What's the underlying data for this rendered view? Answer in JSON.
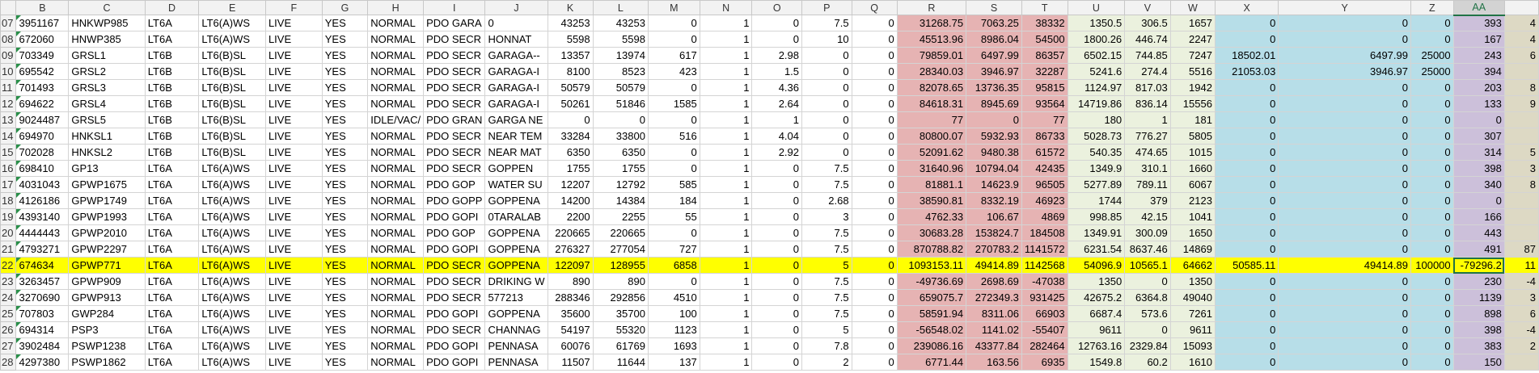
{
  "columns": [
    "",
    "B",
    "C",
    "D",
    "E",
    "F",
    "G",
    "H",
    "I",
    "J",
    "K",
    "L",
    "M",
    "N",
    "O",
    "P",
    "Q",
    "R",
    "S",
    "T",
    "U",
    "V",
    "W",
    "X",
    "Y",
    "Z",
    "AA",
    ""
  ],
  "rows": [
    {
      "rn": "07",
      "cells": [
        "3951167",
        "HNKWP985",
        "LT6A",
        "LT6(A)WS",
        "LIVE",
        "YES",
        "NORMAL",
        "PDO GARA",
        "0",
        "43253",
        "43253",
        "0",
        "1",
        "0",
        "7.5",
        "0",
        "31268.75",
        "7063.25",
        "38332",
        "1350.5",
        "306.5",
        "1657",
        "0",
        "0",
        "0",
        "393",
        "4"
      ]
    },
    {
      "rn": "08",
      "cells": [
        "672060",
        "HNWP385",
        "LT6A",
        "LT6(A)WS",
        "LIVE",
        "YES",
        "NORMAL",
        "PDO SECR",
        "HONNAT",
        "5598",
        "5598",
        "0",
        "1",
        "0",
        "10",
        "0",
        "45513.96",
        "8986.04",
        "54500",
        "1800.26",
        "446.74",
        "2247",
        "0",
        "0",
        "0",
        "167",
        "4"
      ]
    },
    {
      "rn": "09",
      "cells": [
        "703349",
        "GRSL1",
        "LT6B",
        "LT6(B)SL",
        "LIVE",
        "YES",
        "NORMAL",
        "PDO SECR",
        "GARAGA--",
        "13357",
        "13974",
        "617",
        "1",
        "2.98",
        "0",
        "0",
        "79859.01",
        "6497.99",
        "86357",
        "6502.15",
        "744.85",
        "7247",
        "18502.01",
        "6497.99",
        "25000",
        "243",
        "6"
      ]
    },
    {
      "rn": "10",
      "cells": [
        "695542",
        "GRSL2",
        "LT6B",
        "LT6(B)SL",
        "LIVE",
        "YES",
        "NORMAL",
        "PDO SECR",
        "GARAGA-I",
        "8100",
        "8523",
        "423",
        "1",
        "1.5",
        "0",
        "0",
        "28340.03",
        "3946.97",
        "32287",
        "5241.6",
        "274.4",
        "5516",
        "21053.03",
        "3946.97",
        "25000",
        "394",
        ""
      ]
    },
    {
      "rn": "11",
      "cells": [
        "701493",
        "GRSL3",
        "LT6B",
        "LT6(B)SL",
        "LIVE",
        "YES",
        "NORMAL",
        "PDO SECR",
        "GARAGA-I",
        "50579",
        "50579",
        "0",
        "1",
        "4.36",
        "0",
        "0",
        "82078.65",
        "13736.35",
        "95815",
        "1124.97",
        "817.03",
        "1942",
        "0",
        "0",
        "0",
        "203",
        "8"
      ]
    },
    {
      "rn": "12",
      "cells": [
        "694622",
        "GRSL4",
        "LT6B",
        "LT6(B)SL",
        "LIVE",
        "YES",
        "NORMAL",
        "PDO SECR",
        "GARAGA-I",
        "50261",
        "51846",
        "1585",
        "1",
        "2.64",
        "0",
        "0",
        "84618.31",
        "8945.69",
        "93564",
        "14719.86",
        "836.14",
        "15556",
        "0",
        "0",
        "0",
        "133",
        "9"
      ]
    },
    {
      "rn": "13",
      "cells": [
        "9024487",
        "GRSL5",
        "LT6B",
        "LT6(B)SL",
        "LIVE",
        "YES",
        "IDLE/VAC/",
        "PDO GRAN",
        "GARGA NE",
        "0",
        "0",
        "0",
        "1",
        "1",
        "0",
        "0",
        "77",
        "0",
        "77",
        "180",
        "1",
        "181",
        "0",
        "0",
        "0",
        "0",
        ""
      ]
    },
    {
      "rn": "14",
      "cells": [
        "694970",
        "HNKSL1",
        "LT6B",
        "LT6(B)SL",
        "LIVE",
        "YES",
        "NORMAL",
        "PDO SECR",
        "NEAR TEM",
        "33284",
        "33800",
        "516",
        "1",
        "4.04",
        "0",
        "0",
        "80800.07",
        "5932.93",
        "86733",
        "5028.73",
        "776.27",
        "5805",
        "0",
        "0",
        "0",
        "307",
        ""
      ]
    },
    {
      "rn": "15",
      "cells": [
        "702028",
        "HNKSL2",
        "LT6B",
        "LT6(B)SL",
        "LIVE",
        "YES",
        "NORMAL",
        "PDO SECR",
        "NEAR MAT",
        "6350",
        "6350",
        "0",
        "1",
        "2.92",
        "0",
        "0",
        "52091.62",
        "9480.38",
        "61572",
        "540.35",
        "474.65",
        "1015",
        "0",
        "0",
        "0",
        "314",
        "5"
      ]
    },
    {
      "rn": "16",
      "cells": [
        "698410",
        "GP13",
        "LT6A",
        "LT6(A)WS",
        "LIVE",
        "YES",
        "NORMAL",
        "PDO SECR",
        "GOPPEN",
        "1755",
        "1755",
        "0",
        "1",
        "0",
        "7.5",
        "0",
        "31640.96",
        "10794.04",
        "42435",
        "1349.9",
        "310.1",
        "1660",
        "0",
        "0",
        "0",
        "398",
        "3"
      ]
    },
    {
      "rn": "17",
      "cells": [
        "4031043",
        "GPWP1675",
        "LT6A",
        "LT6(A)WS",
        "LIVE",
        "YES",
        "NORMAL",
        "PDO GOP",
        "WATER SU",
        "12207",
        "12792",
        "585",
        "1",
        "0",
        "7.5",
        "0",
        "81881.1",
        "14623.9",
        "96505",
        "5277.89",
        "789.11",
        "6067",
        "0",
        "0",
        "0",
        "340",
        "8"
      ]
    },
    {
      "rn": "18",
      "cells": [
        "4126186",
        "GPWP1749",
        "LT6A",
        "LT6(A)WS",
        "LIVE",
        "YES",
        "NORMAL",
        "PDO GOPP",
        "GOPPENA",
        "14200",
        "14384",
        "184",
        "1",
        "0",
        "2.68",
        "0",
        "38590.81",
        "8332.19",
        "46923",
        "1744",
        "379",
        "2123",
        "0",
        "0",
        "0",
        "0",
        ""
      ]
    },
    {
      "rn": "19",
      "cells": [
        "4393140",
        "GPWP1993",
        "LT6A",
        "LT6(A)WS",
        "LIVE",
        "YES",
        "NORMAL",
        "PDO GOPI",
        "0TARALAB",
        "2200",
        "2255",
        "55",
        "1",
        "0",
        "3",
        "0",
        "4762.33",
        "106.67",
        "4869",
        "998.85",
        "42.15",
        "1041",
        "0",
        "0",
        "0",
        "166",
        ""
      ]
    },
    {
      "rn": "20",
      "cells": [
        "4444443",
        "GPWP2010",
        "LT6A",
        "LT6(A)WS",
        "LIVE",
        "YES",
        "NORMAL",
        "PDO GOP",
        "GOPPENA",
        "220665",
        "220665",
        "0",
        "1",
        "0",
        "7.5",
        "0",
        "30683.28",
        "153824.7",
        "184508",
        "1349.91",
        "300.09",
        "1650",
        "0",
        "0",
        "0",
        "443",
        ""
      ]
    },
    {
      "rn": "21",
      "cells": [
        "4793271",
        "GPWP2297",
        "LT6A",
        "LT6(A)WS",
        "LIVE",
        "YES",
        "NORMAL",
        "PDO GOPI",
        "GOPPENA",
        "276327",
        "277054",
        "727",
        "1",
        "0",
        "7.5",
        "0",
        "870788.82",
        "270783.2",
        "1141572",
        "6231.54",
        "8637.46",
        "14869",
        "0",
        "0",
        "0",
        "491",
        "87"
      ]
    },
    {
      "rn": "22",
      "cells": [
        "674634",
        "GPWP771",
        "LT6A",
        "LT6(A)WS",
        "LIVE",
        "YES",
        "NORMAL",
        "PDO SECR",
        "GOPPENA",
        "122097",
        "128955",
        "6858",
        "1",
        "0",
        "5",
        "0",
        "1093153.11",
        "49414.89",
        "1142568",
        "54096.9",
        "10565.1",
        "64662",
        "50585.11",
        "49414.89",
        "100000",
        "-79296.2",
        "11"
      ],
      "highlight": true
    },
    {
      "rn": "23",
      "cells": [
        "3263457",
        "GPWP909",
        "LT6A",
        "LT6(A)WS",
        "LIVE",
        "YES",
        "NORMAL",
        "PDO SECR",
        "DRIKING W",
        "890",
        "890",
        "0",
        "1",
        "0",
        "7.5",
        "0",
        "-49736.69",
        "2698.69",
        "-47038",
        "1350",
        "0",
        "1350",
        "0",
        "0",
        "0",
        "230",
        "-4"
      ]
    },
    {
      "rn": "24",
      "cells": [
        "3270690",
        "GPWP913",
        "LT6A",
        "LT6(A)WS",
        "LIVE",
        "YES",
        "NORMAL",
        "PDO SECR",
        "577213",
        "288346",
        "292856",
        "4510",
        "1",
        "0",
        "7.5",
        "0",
        "659075.7",
        "272349.3",
        "931425",
        "42675.2",
        "6364.8",
        "49040",
        "0",
        "0",
        "0",
        "1139",
        "3"
      ]
    },
    {
      "rn": "25",
      "cells": [
        "707803",
        "GWP284",
        "LT6A",
        "LT6(A)WS",
        "LIVE",
        "YES",
        "NORMAL",
        "PDO GOPI",
        "GOPPENA",
        "35600",
        "35700",
        "100",
        "1",
        "0",
        "7.5",
        "0",
        "58591.94",
        "8311.06",
        "66903",
        "6687.4",
        "573.6",
        "7261",
        "0",
        "0",
        "0",
        "898",
        "6"
      ]
    },
    {
      "rn": "26",
      "cells": [
        "694314",
        "PSP3",
        "LT6A",
        "LT6(A)WS",
        "LIVE",
        "YES",
        "NORMAL",
        "PDO SECR",
        "CHANNAG",
        "54197",
        "55320",
        "1123",
        "1",
        "0",
        "5",
        "0",
        "-56548.02",
        "1141.02",
        "-55407",
        "9611",
        "0",
        "9611",
        "0",
        "0",
        "0",
        "398",
        "-4"
      ]
    },
    {
      "rn": "27",
      "cells": [
        "3902484",
        "PSWP1238",
        "LT6A",
        "LT6(A)WS",
        "LIVE",
        "YES",
        "NORMAL",
        "PDO GOPI",
        "PENNASA",
        "60076",
        "61769",
        "1693",
        "1",
        "0",
        "7.8",
        "0",
        "239086.16",
        "43377.84",
        "282464",
        "12763.16",
        "2329.84",
        "15093",
        "0",
        "0",
        "0",
        "383",
        "2"
      ]
    },
    {
      "rn": "28",
      "cells": [
        "4297380",
        "PSWP1862",
        "LT6A",
        "LT6(A)WS",
        "LIVE",
        "YES",
        "NORMAL",
        "PDO GOPI",
        "PENNASA",
        "11507",
        "11644",
        "137",
        "1",
        "0",
        "2",
        "0",
        "6771.44",
        "163.56",
        "6935",
        "1549.8",
        "60.2",
        "1610",
        "0",
        "0",
        "0",
        "150",
        ""
      ]
    }
  ]
}
